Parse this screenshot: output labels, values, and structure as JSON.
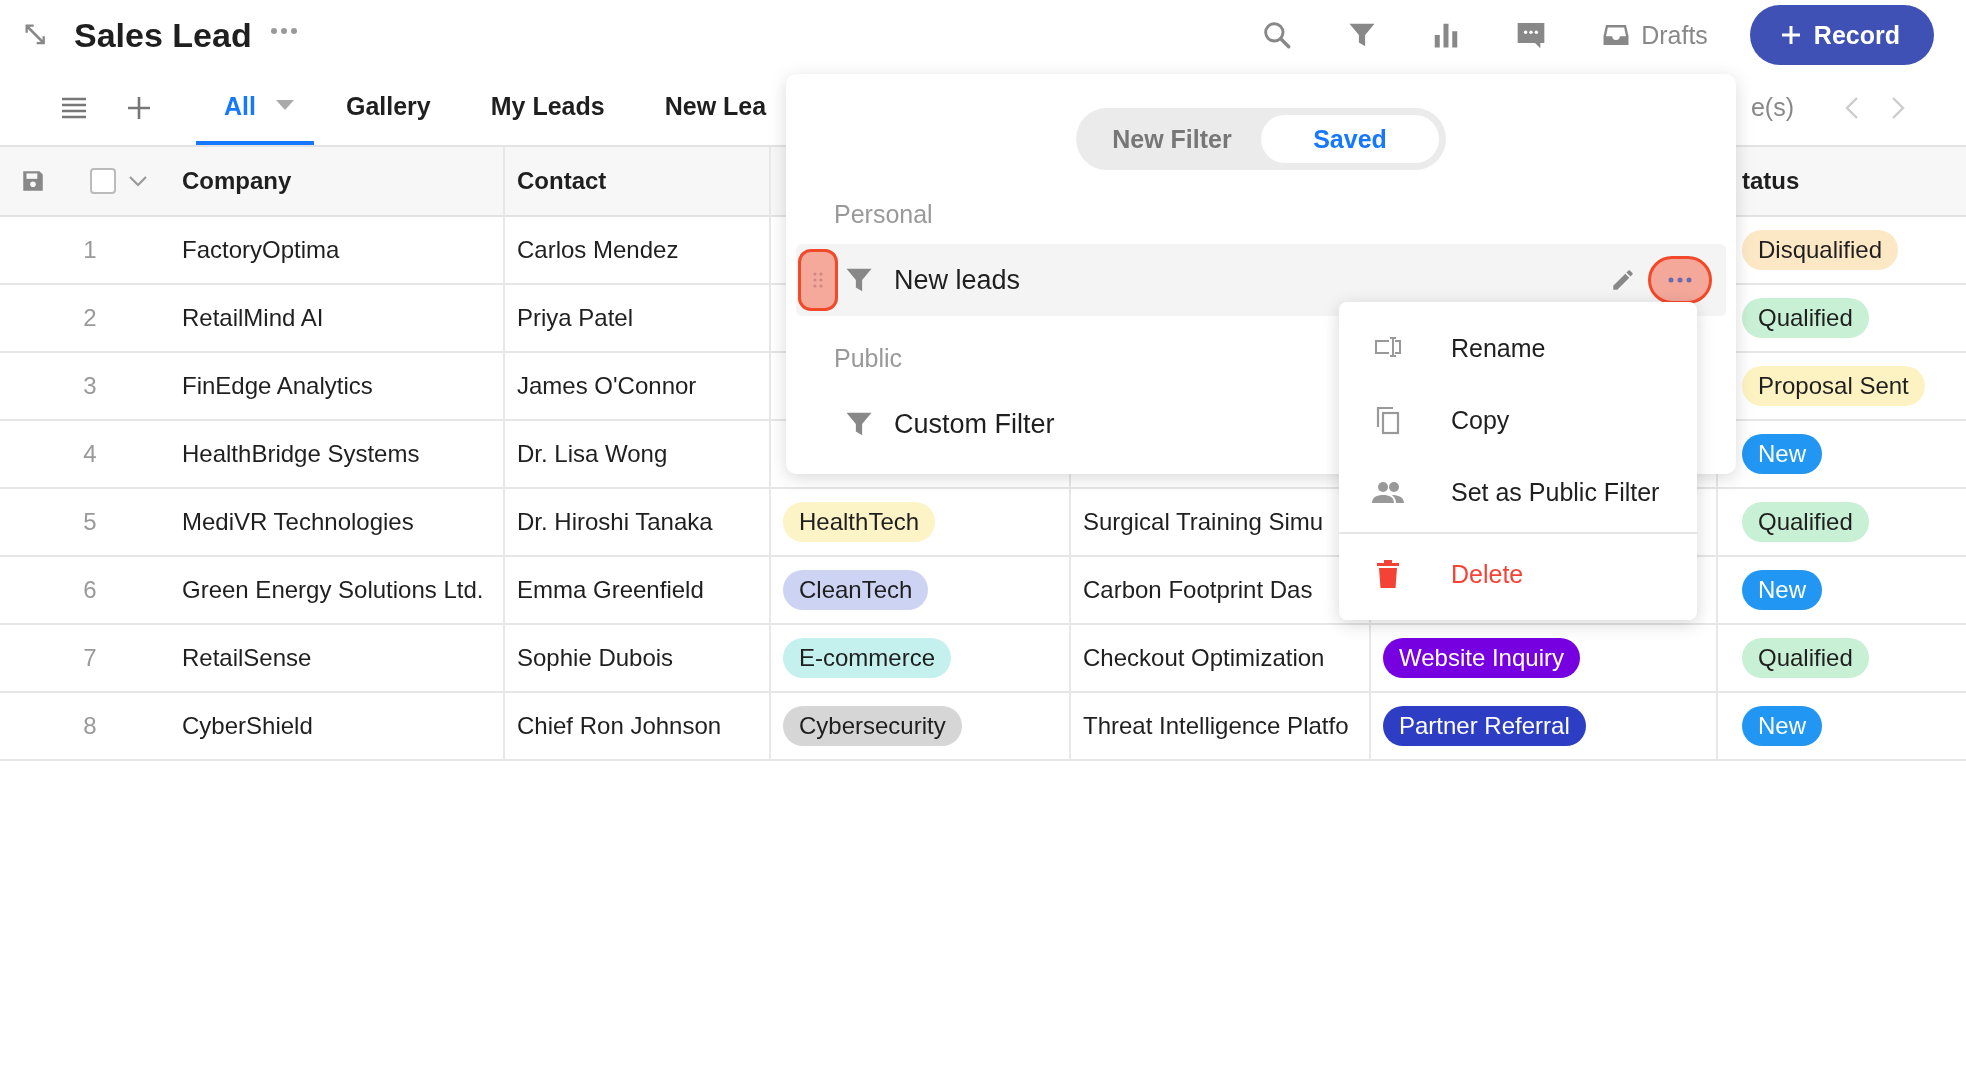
{
  "header": {
    "title": "Sales Lead",
    "drafts_label": "Drafts",
    "record_button": "Record"
  },
  "tabs": [
    {
      "label": "All",
      "selected": true
    },
    {
      "label": "Gallery",
      "selected": false
    },
    {
      "label": "My Leads",
      "selected": false
    },
    {
      "label": "New Lea",
      "selected": false
    }
  ],
  "pager": {
    "label": "e(s)"
  },
  "table": {
    "select_all": {
      "checked": false
    },
    "columns": {
      "company": "Company",
      "contact": "Contact",
      "status": "tatus"
    },
    "rows": [
      {
        "number": "1",
        "company": "FactoryOptima",
        "contact": "Carlos Mendez",
        "status": {
          "label": "Disqualified",
          "color": "#fde8c6"
        }
      },
      {
        "number": "2",
        "company": "RetailMind AI",
        "contact": "Priya Patel",
        "status": {
          "label": "Qualified",
          "color": "#c8f0d5"
        }
      },
      {
        "number": "3",
        "company": "FinEdge Analytics",
        "contact": "James O'Connor",
        "status": {
          "label": "Proposal Sent",
          "color": "#fdf3c2"
        }
      },
      {
        "number": "4",
        "company": "HealthBridge Systems",
        "contact": "Dr. Lisa Wong",
        "status": {
          "label": "New",
          "color": "#2196f3"
        }
      },
      {
        "number": "5",
        "company": "MediVR Technologies",
        "contact": "Dr. Hiroshi Tanaka",
        "industry": {
          "label": "HealthTech",
          "color": "#fcf3c6"
        },
        "project": "Surgical Training Simu",
        "status": {
          "label": "Qualified",
          "color": "#c8f0d5"
        }
      },
      {
        "number": "6",
        "company": "Green Energy Solutions Ltd.",
        "contact": "Emma Greenfield",
        "industry": {
          "label": "CleanTech",
          "color": "#cdd3f3"
        },
        "project": "Carbon Footprint Das",
        "status": {
          "label": "New",
          "color": "#2196f3"
        }
      },
      {
        "number": "7",
        "company": "RetailSense",
        "contact": "Sophie Dubois",
        "industry": {
          "label": "E-commerce",
          "color": "#c4f1ee"
        },
        "project": "Checkout Optimization",
        "source": {
          "label": "Website Inquiry",
          "color": "#7700e0"
        },
        "status": {
          "label": "Qualified",
          "color": "#c8f0d5"
        }
      },
      {
        "number": "8",
        "company": "CyberShield",
        "contact": "Chief Ron Johnson",
        "industry": {
          "label": "Cybersecurity",
          "color": "#d6d6d6"
        },
        "project": "Threat Intelligence Platfo",
        "source": {
          "label": "Partner Referral",
          "color": "#2d3ec5"
        },
        "status": {
          "label": "New",
          "color": "#2196f3"
        }
      }
    ]
  },
  "filter_panel": {
    "modes": [
      {
        "label": "New Filter",
        "selected": false
      },
      {
        "label": "Saved",
        "selected": true
      }
    ],
    "sections": [
      {
        "title": "Personal",
        "items": [
          {
            "label": "New leads",
            "selected": true
          }
        ]
      },
      {
        "title": "Public",
        "items": [
          {
            "label": "Custom Filter",
            "selected": false
          }
        ]
      }
    ]
  },
  "context_menu": {
    "items": [
      {
        "label": "Rename",
        "kind": "rename"
      },
      {
        "label": "Copy",
        "kind": "copy"
      },
      {
        "label": "Set as Public Filter",
        "kind": "share"
      },
      {
        "label": "Delete",
        "kind": "delete"
      }
    ]
  }
}
